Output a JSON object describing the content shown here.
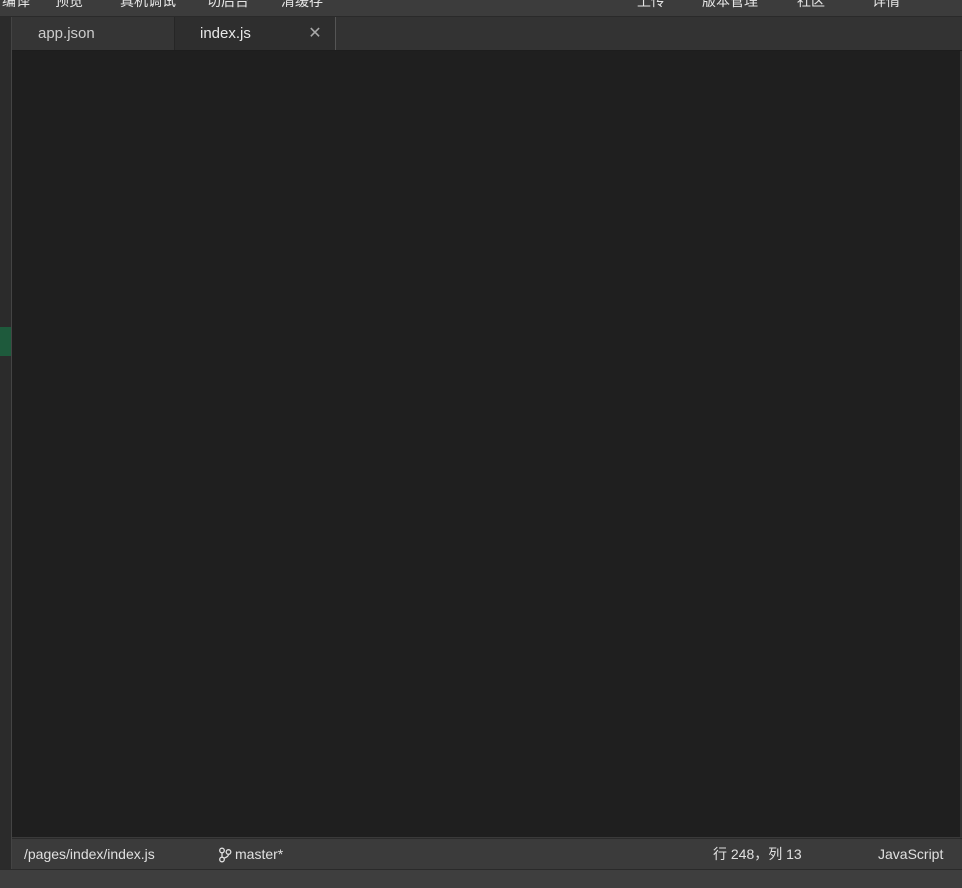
{
  "toolbar": {
    "left_items": [
      "编译",
      "预览",
      "真机调试",
      "切后台",
      "清缓存"
    ],
    "right_items": [
      "上传",
      "版本管理",
      "社区",
      "详情"
    ]
  },
  "tabs": [
    {
      "label": "app.json",
      "active": false
    },
    {
      "label": "index.js",
      "active": true,
      "close_icon": "close-icon"
    }
  ],
  "status": {
    "path": "/pages/index/index.js",
    "branch_icon": "git-branch-icon",
    "branch": "master*",
    "cursor": "行 248，列 13",
    "language": "JavaScript"
  },
  "colors": {
    "editor_bg": "#1f1f1f",
    "tabbar_bg": "#333333",
    "statusbar_bg": "#3b3b3b",
    "gutter_marker": "#1e5a3c"
  }
}
